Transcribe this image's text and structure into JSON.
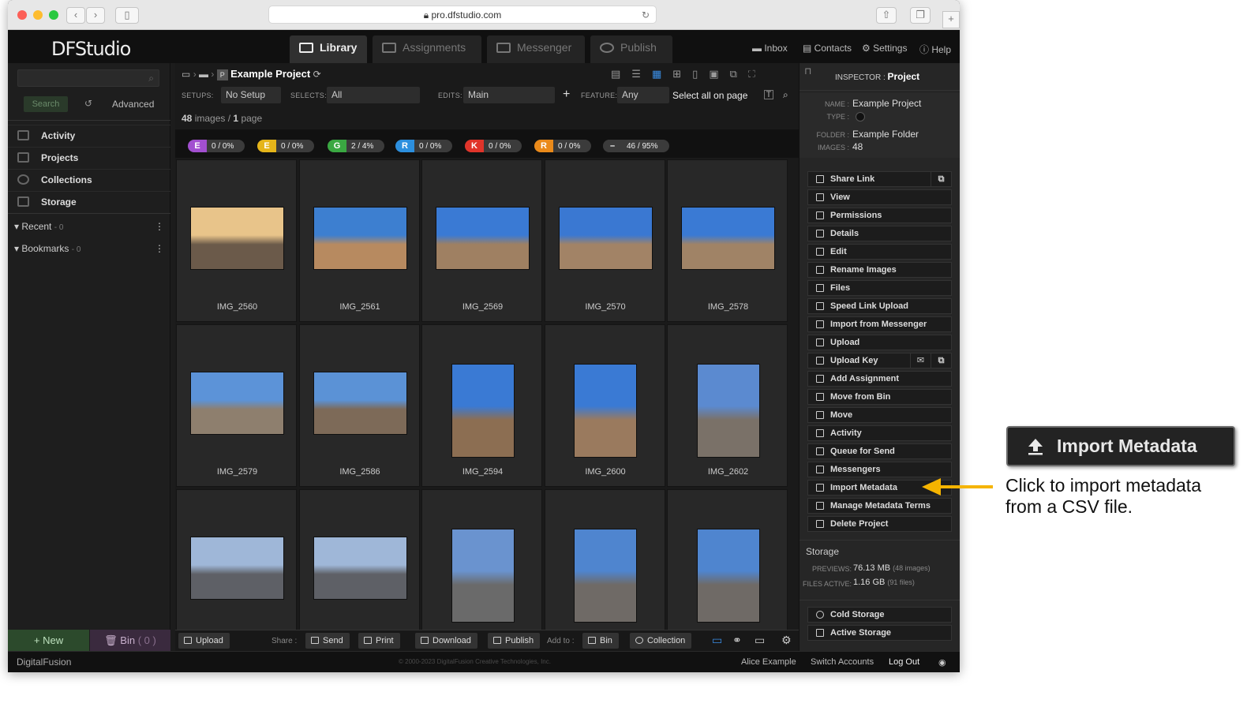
{
  "browser": {
    "url": "pro.dfstudio.com"
  },
  "app": {
    "logo": "DFStudio",
    "tabs": [
      "Library",
      "Assignments",
      "Messenger",
      "Publish"
    ],
    "links": [
      "Inbox",
      "Contacts",
      "Settings",
      "Help"
    ]
  },
  "sidebar": {
    "search_btn": "Search",
    "advanced": "Advanced",
    "items": [
      "Activity",
      "Projects",
      "Collections",
      "Storage"
    ],
    "recent": "Recent",
    "recent_count": "- 0",
    "bookmarks": "Bookmarks",
    "bookmarks_count": "- 0",
    "new_btn": "New",
    "bin_btn": "Bin",
    "bin_count": "( 0 )"
  },
  "breadcrumb": {
    "title": "Example Project",
    "p_badge": "P"
  },
  "filters": {
    "setups_label": "SETUPS:",
    "setups": "No Setup",
    "selects_label": "SELECTS:",
    "selects": "All",
    "edits_label": "EDITS:",
    "edits": "Main",
    "feature_label": "FEATURE:",
    "feature": "Any",
    "select_all": "Select all on page"
  },
  "count": {
    "images": "48",
    "images_label": "images /",
    "pages": "1",
    "pages_label": "page"
  },
  "pills": [
    {
      "l": "E",
      "v": "0 / 0%",
      "c": "#a24fd0"
    },
    {
      "l": "E",
      "v": "0 / 0%",
      "c": "#e5b51a"
    },
    {
      "l": "G",
      "v": "2 / 4%",
      "c": "#3aa842"
    },
    {
      "l": "R",
      "v": "0 / 0%",
      "c": "#2c8fde"
    },
    {
      "l": "K",
      "v": "0 / 0%",
      "c": "#e0342a"
    },
    {
      "l": "R",
      "v": "0 / 0%",
      "c": "#ea8a1a"
    },
    {
      "l": "–",
      "v": "46 / 95%",
      "c": "#3b3b3b"
    }
  ],
  "images": [
    {
      "name": "IMG_2560",
      "o": "l",
      "sky": "#e8c48a",
      "gr": "#6b5a4a"
    },
    {
      "name": "IMG_2561",
      "o": "l",
      "sky": "#3d7fd0",
      "gr": "#b78a60"
    },
    {
      "name": "IMG_2569",
      "o": "l",
      "sky": "#3a7ad4",
      "gr": "#9f8062"
    },
    {
      "name": "IMG_2570",
      "o": "l",
      "sky": "#3a78d2",
      "gr": "#a28366"
    },
    {
      "name": "IMG_2578",
      "o": "l",
      "sky": "#3a7ad4",
      "gr": "#a08366"
    },
    {
      "name": "IMG_2579",
      "o": "l",
      "sky": "#5c93d8",
      "gr": "#8e7f6e"
    },
    {
      "name": "IMG_2586",
      "o": "l",
      "sky": "#5b92d6",
      "gr": "#7d6a58"
    },
    {
      "name": "IMG_2594",
      "o": "p",
      "sky": "#3a7ad4",
      "gr": "#8c6e52"
    },
    {
      "name": "IMG_2600",
      "o": "p",
      "sky": "#3a7ad4",
      "gr": "#9a7a5e"
    },
    {
      "name": "IMG_2602",
      "o": "p",
      "sky": "#5b8ad0",
      "gr": "#7a7168"
    },
    {
      "name": "",
      "o": "l",
      "sky": "#9fb7d8",
      "gr": "#5e6066"
    },
    {
      "name": "",
      "o": "l",
      "sky": "#9fb7d8",
      "gr": "#5e6066"
    },
    {
      "name": "",
      "o": "p",
      "sky": "#6a93cf",
      "gr": "#6a6a6a"
    },
    {
      "name": "",
      "o": "p",
      "sky": "#4f85cf",
      "gr": "#6f6a66"
    },
    {
      "name": "",
      "o": "p",
      "sky": "#4f85cf",
      "gr": "#6f6a66"
    }
  ],
  "bottom": {
    "upload": "Upload",
    "share_label": "Share :",
    "send": "Send",
    "print": "Print",
    "download": "Download",
    "publish": "Publish",
    "addto_label": "Add to :",
    "bin": "Bin",
    "collection": "Collection"
  },
  "inspector": {
    "label": "INSPECTOR :",
    "title": "Project",
    "name_label": "NAME :",
    "name": "Example Project",
    "type_label": "TYPE :",
    "folder_label": "FOLDER :",
    "folder": "Example Folder",
    "images_label": "IMAGES :",
    "images": "48",
    "actions": [
      "Share Link",
      "View",
      "Permissions",
      "Details",
      "Edit",
      "Rename Images",
      "Files",
      "Speed Link Upload",
      "Import from Messenger",
      "Upload",
      "Upload Key",
      "Add Assignment",
      "Move from Bin",
      "Move",
      "Activity",
      "Queue for Send",
      "Messengers",
      "Import Metadata",
      "Manage Metadata Terms",
      "Delete Project"
    ],
    "storage_title": "Storage",
    "previews_label": "PREVIEWS:",
    "previews": "76.13 MB",
    "previews_sub": "(48 images)",
    "files_label": "FILES ACTIVE:",
    "files": "1.16 GB",
    "files_sub": "(91 files)",
    "cold": "Cold Storage",
    "active": "Active Storage"
  },
  "footer": {
    "brand": "DigitalFusion",
    "copyright": "© 2000-2023 DigitalFusion Creative Technologies, Inc.",
    "user": "Alice Example",
    "switch": "Switch Accounts",
    "logout": "Log Out"
  },
  "annotation": {
    "callout": "Import Metadata",
    "note": "Click to import metadata from a CSV file.",
    "arrow_color": "#f5b400"
  }
}
